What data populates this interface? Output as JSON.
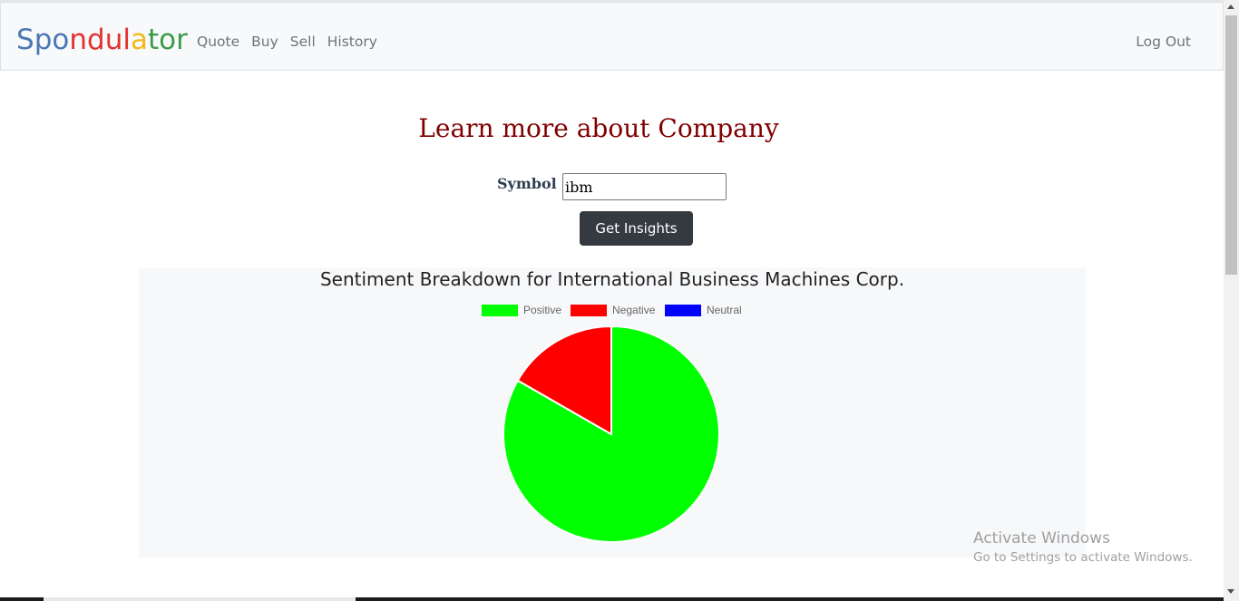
{
  "navbar": {
    "brand_letters": [
      {
        "ch": "S",
        "color": "#4a78b5"
      },
      {
        "ch": "p",
        "color": "#4a78b5"
      },
      {
        "ch": "o",
        "color": "#4a78b5"
      },
      {
        "ch": "n",
        "color": "#e0322f"
      },
      {
        "ch": "d",
        "color": "#e0322f"
      },
      {
        "ch": "u",
        "color": "#e0322f"
      },
      {
        "ch": "l",
        "color": "#e0322f"
      },
      {
        "ch": "a",
        "color": "#f2b91e"
      },
      {
        "ch": "t",
        "color": "#3a9b49"
      },
      {
        "ch": "o",
        "color": "#3a9b49"
      },
      {
        "ch": "r",
        "color": "#3a9b49"
      }
    ],
    "links": [
      "Quote",
      "Buy",
      "Sell",
      "History"
    ],
    "logout_label": "Log Out"
  },
  "main": {
    "heading": "Learn more about Company",
    "symbol_label": "Symbol :",
    "symbol_value": "ibm",
    "button_label": "Get Insights"
  },
  "chart_data": {
    "type": "pie",
    "title": "Sentiment Breakdown for International Business Machines Corp.",
    "legend_position": "top",
    "categories": [
      "Positive",
      "Negative",
      "Neutral"
    ],
    "values": [
      83.3,
      16.7,
      0
    ],
    "colors": [
      "#00ff00",
      "#ff0000",
      "#0000ff"
    ]
  },
  "watermark": {
    "title": "Activate Windows",
    "subtitle": "Go to Settings to activate Windows."
  }
}
